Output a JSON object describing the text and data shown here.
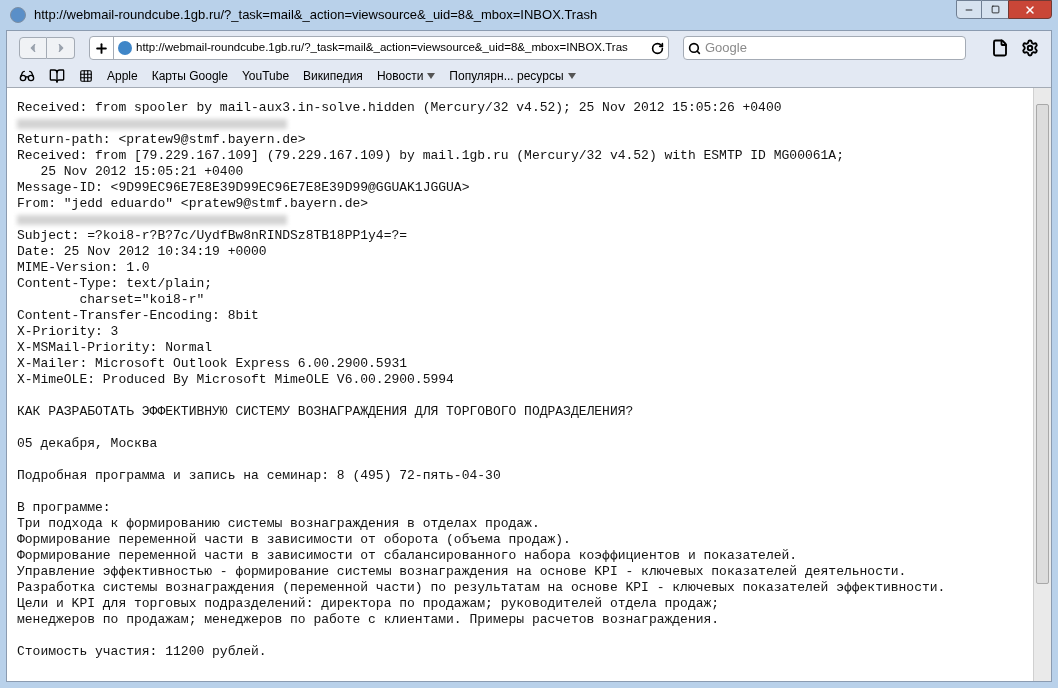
{
  "window": {
    "title": "http://webmail-roundcube.1gb.ru/?_task=mail&_action=viewsource&_uid=8&_mbox=INBOX.Trash"
  },
  "toolbar": {
    "address": "http://webmail-roundcube.1gb.ru/?_task=mail&_action=viewsource&_uid=8&_mbox=INBOX.Tras",
    "search_placeholder": "Google"
  },
  "bookmarks": [
    {
      "label": "Apple",
      "menu": false
    },
    {
      "label": "Карты Google",
      "menu": false
    },
    {
      "label": "YouTube",
      "menu": false
    },
    {
      "label": "Википедия",
      "menu": false
    },
    {
      "label": "Новости",
      "menu": true
    },
    {
      "label": "Популярн... ресурсы",
      "menu": true
    }
  ],
  "lines": [
    {
      "kind": "text",
      "text": "Received: from spooler by mail-aux3.in-solve.hidden (Mercury/32 v4.52); 25 Nov 2012 15:05:26 +0400"
    },
    {
      "kind": "redacted"
    },
    {
      "kind": "text",
      "text": "Return-path: <pratew9@stmf.bayern.de>"
    },
    {
      "kind": "text",
      "text": "Received: from [79.229.167.109] (79.229.167.109) by mail.1gb.ru (Mercury/32 v4.52) with ESMTP ID MG00061A;"
    },
    {
      "kind": "text",
      "text": "   25 Nov 2012 15:05:21 +0400"
    },
    {
      "kind": "text",
      "text": "Message-ID: <9D99EC96E7E8E39D99EC96E7E8E39D99@GGUAK1JGGUA>"
    },
    {
      "kind": "text",
      "text": "From: \"jedd eduardo\" <pratew9@stmf.bayern.de>"
    },
    {
      "kind": "redacted"
    },
    {
      "kind": "text",
      "text": "Subject: =?koi8-r?B?7c/UydfBw8nRINDSz8TB18PP1y4=?="
    },
    {
      "kind": "text",
      "text": "Date: 25 Nov 2012 10:34:19 +0000"
    },
    {
      "kind": "text",
      "text": "MIME-Version: 1.0"
    },
    {
      "kind": "text",
      "text": "Content-Type: text/plain;"
    },
    {
      "kind": "text",
      "text": "        charset=\"koi8-r\""
    },
    {
      "kind": "text",
      "text": "Content-Transfer-Encoding: 8bit"
    },
    {
      "kind": "text",
      "text": "X-Priority: 3"
    },
    {
      "kind": "text",
      "text": "X-MSMail-Priority: Normal"
    },
    {
      "kind": "text",
      "text": "X-Mailer: Microsoft Outlook Express 6.00.2900.5931"
    },
    {
      "kind": "text",
      "text": "X-MimeOLE: Produced By Microsoft MimeOLE V6.00.2900.5994"
    },
    {
      "kind": "blank"
    },
    {
      "kind": "text",
      "text": "КАК РАЗРАБОТАТЬ ЭФФЕКТИВНУЮ СИСТЕМУ ВОЗНАГРАЖДЕНИЯ ДЛЯ ТОРГОВОГО ПОДРАЗДЕЛЕНИЯ?"
    },
    {
      "kind": "blank"
    },
    {
      "kind": "text",
      "text": "05 декабря, Москва"
    },
    {
      "kind": "blank"
    },
    {
      "kind": "text",
      "text": "Подробная программа и запись на семинар: 8 (495) 72-пять-04-30"
    },
    {
      "kind": "blank"
    },
    {
      "kind": "text",
      "text": "В программе:"
    },
    {
      "kind": "text",
      "text": "Три подхода к формированию системы вознаграждения в отделах продаж."
    },
    {
      "kind": "text",
      "text": "Формирование переменной части в зависимости от оборота (объема продаж)."
    },
    {
      "kind": "text",
      "text": "Формирование переменной части в зависимости от сбалансированного набора коэффициентов и показателей."
    },
    {
      "kind": "text",
      "text": "Управление эффективностью - формирование системы вознаграждения на основе KPI - ключевых показателей деятельности."
    },
    {
      "kind": "text",
      "text": "Разработка системы вознаграждения (переменной части) по результатам на основе KPI - ключевых показателей эффективности."
    },
    {
      "kind": "text",
      "text": "Цели и KPI для торговых подразделений: директора по продажам; руководителей отдела продаж;"
    },
    {
      "kind": "text",
      "text": "менеджеров по продажам; менеджеров по работе с клиентами. Примеры расчетов вознаграждения."
    },
    {
      "kind": "blank"
    },
    {
      "kind": "text",
      "text": "Стоимость участия: 11200 рублей."
    }
  ]
}
